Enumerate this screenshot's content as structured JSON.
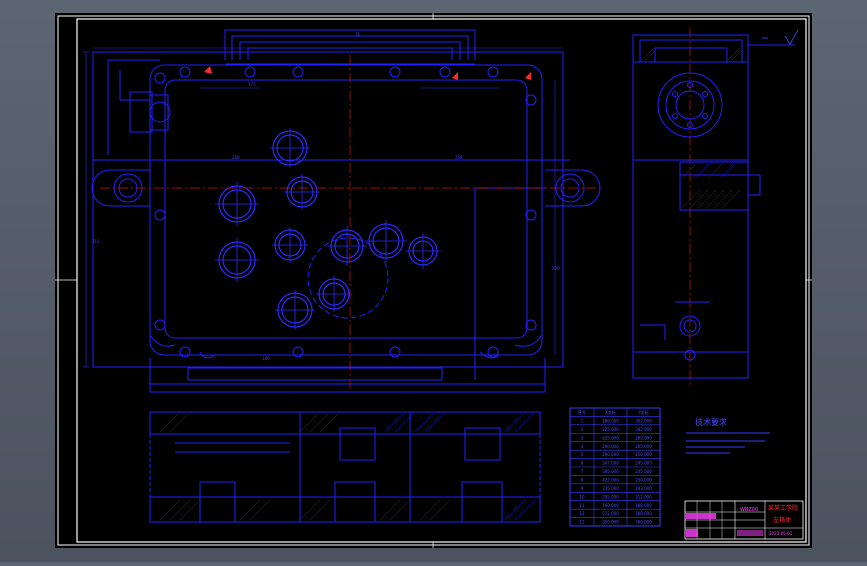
{
  "colors": {
    "background": "#4e5762",
    "paper": "#000000",
    "border": "#ffffff",
    "geometry": "#1a1aff",
    "centerline": "#d01010",
    "label": "#ff40ff",
    "title_text": "#ff2a2a"
  },
  "title_block": {
    "company": "某某工学院",
    "sub": "左箱体",
    "code": "WBZ00",
    "date": "2023-05-01"
  },
  "tech_requirements_title": "技术要求",
  "table": {
    "headers": [
      "序号",
      "X坐标",
      "Y坐标"
    ],
    "rows": [
      [
        "1",
        "186.000",
        "302.000"
      ],
      [
        "2",
        "225.000",
        "282.000"
      ],
      [
        "3",
        "225.000",
        "262.000"
      ],
      [
        "4",
        "290.000",
        "205.000"
      ],
      [
        "5",
        "290.000",
        "250.000"
      ],
      [
        "6",
        "347.000",
        "245.000"
      ],
      [
        "7",
        "385.000",
        "245.000"
      ],
      [
        "8",
        "422.000",
        "250.000"
      ],
      [
        "9",
        "335.000",
        "293.000"
      ],
      [
        "10",
        "295.000",
        "312.000"
      ],
      [
        "11",
        "160.000",
        "188.000"
      ],
      [
        "12",
        "572.000",
        "188.000"
      ],
      [
        "13",
        "350.000",
        "380.000"
      ]
    ]
  }
}
